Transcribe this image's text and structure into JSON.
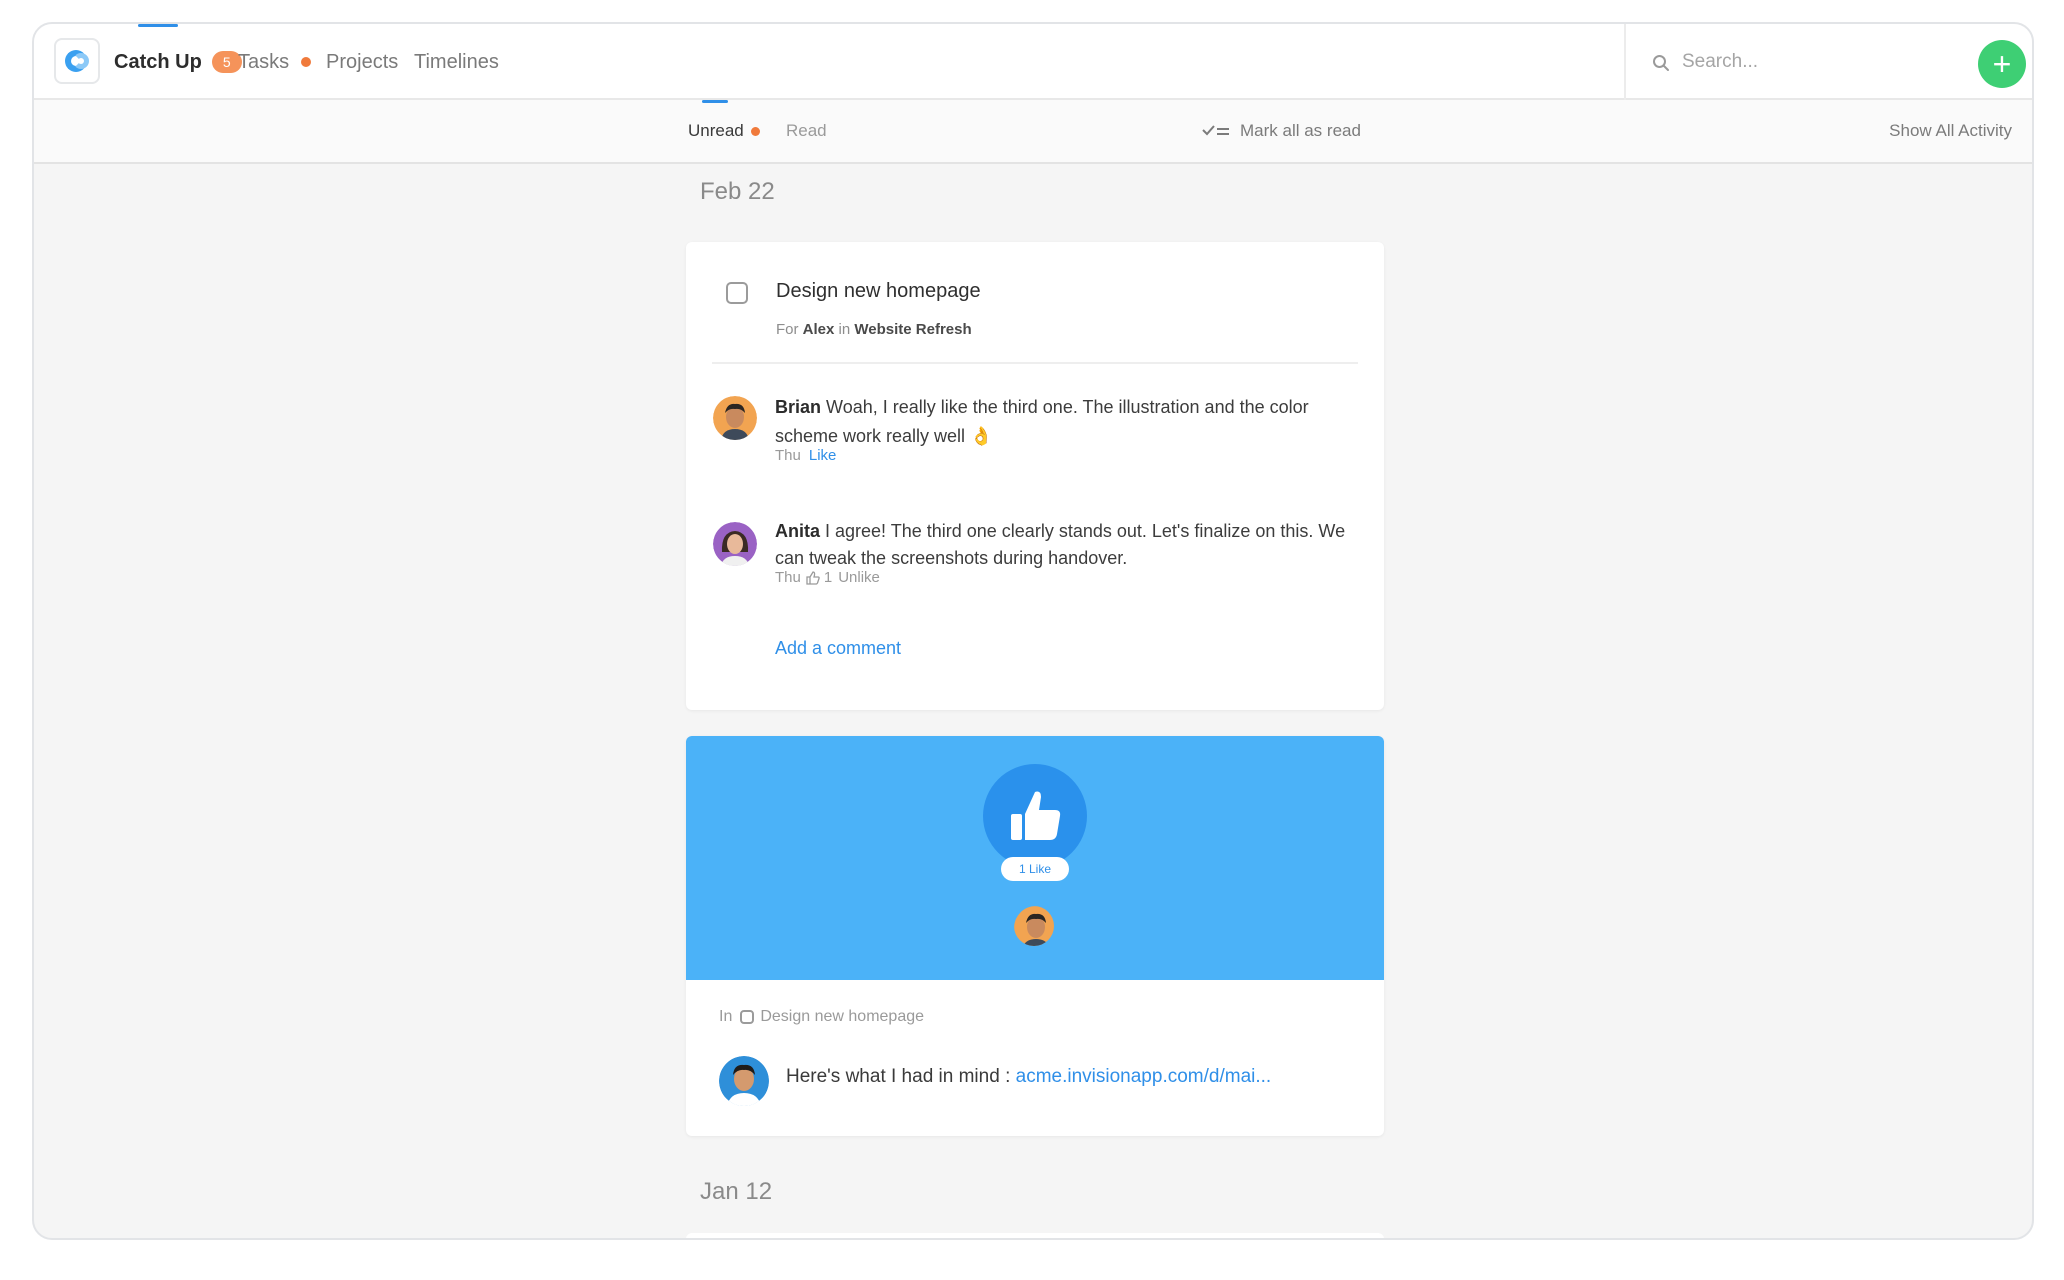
{
  "nav": {
    "tabs": [
      {
        "label": "Catch Up",
        "badge": "5"
      },
      {
        "label": "Tasks"
      },
      {
        "label": "Projects"
      },
      {
        "label": "Timelines"
      }
    ],
    "search_placeholder": "Search...",
    "add_label": "+"
  },
  "subnav": {
    "unread": "Unread",
    "read": "Read",
    "mark_all": "Mark all as read",
    "show_all": "Show All Activity"
  },
  "feed": {
    "date1": "Feb 22",
    "task_card": {
      "title": "Design new homepage",
      "meta_for": "For",
      "meta_person": "Alex",
      "meta_in": "in",
      "meta_project": "Website Refresh",
      "comments": [
        {
          "author": "Brian",
          "text": "Woah, I really like the third one. The illustration and the color scheme work really well",
          "emoji": "👌",
          "day": "Thu",
          "action": "Like"
        },
        {
          "author": "Anita",
          "text": "I agree! The third one clearly stands out. Let's finalize on this. We can tweak the screenshots during handover.",
          "day": "Thu",
          "likes": "1",
          "action": "Unlike"
        }
      ],
      "add_comment": "Add a comment"
    },
    "like_card": {
      "like_count": "1 Like",
      "in_label": "In",
      "task_ref": "Design new homepage",
      "message": "Here's what I had in mind :",
      "link": "acme.invisionapp.com/d/mai..."
    },
    "date2": "Jan 12"
  },
  "colors": {
    "accent": "#2f8fe8",
    "badge": "#f5935a",
    "add_button": "#3ecf74",
    "banner": "#4bb2f8"
  }
}
